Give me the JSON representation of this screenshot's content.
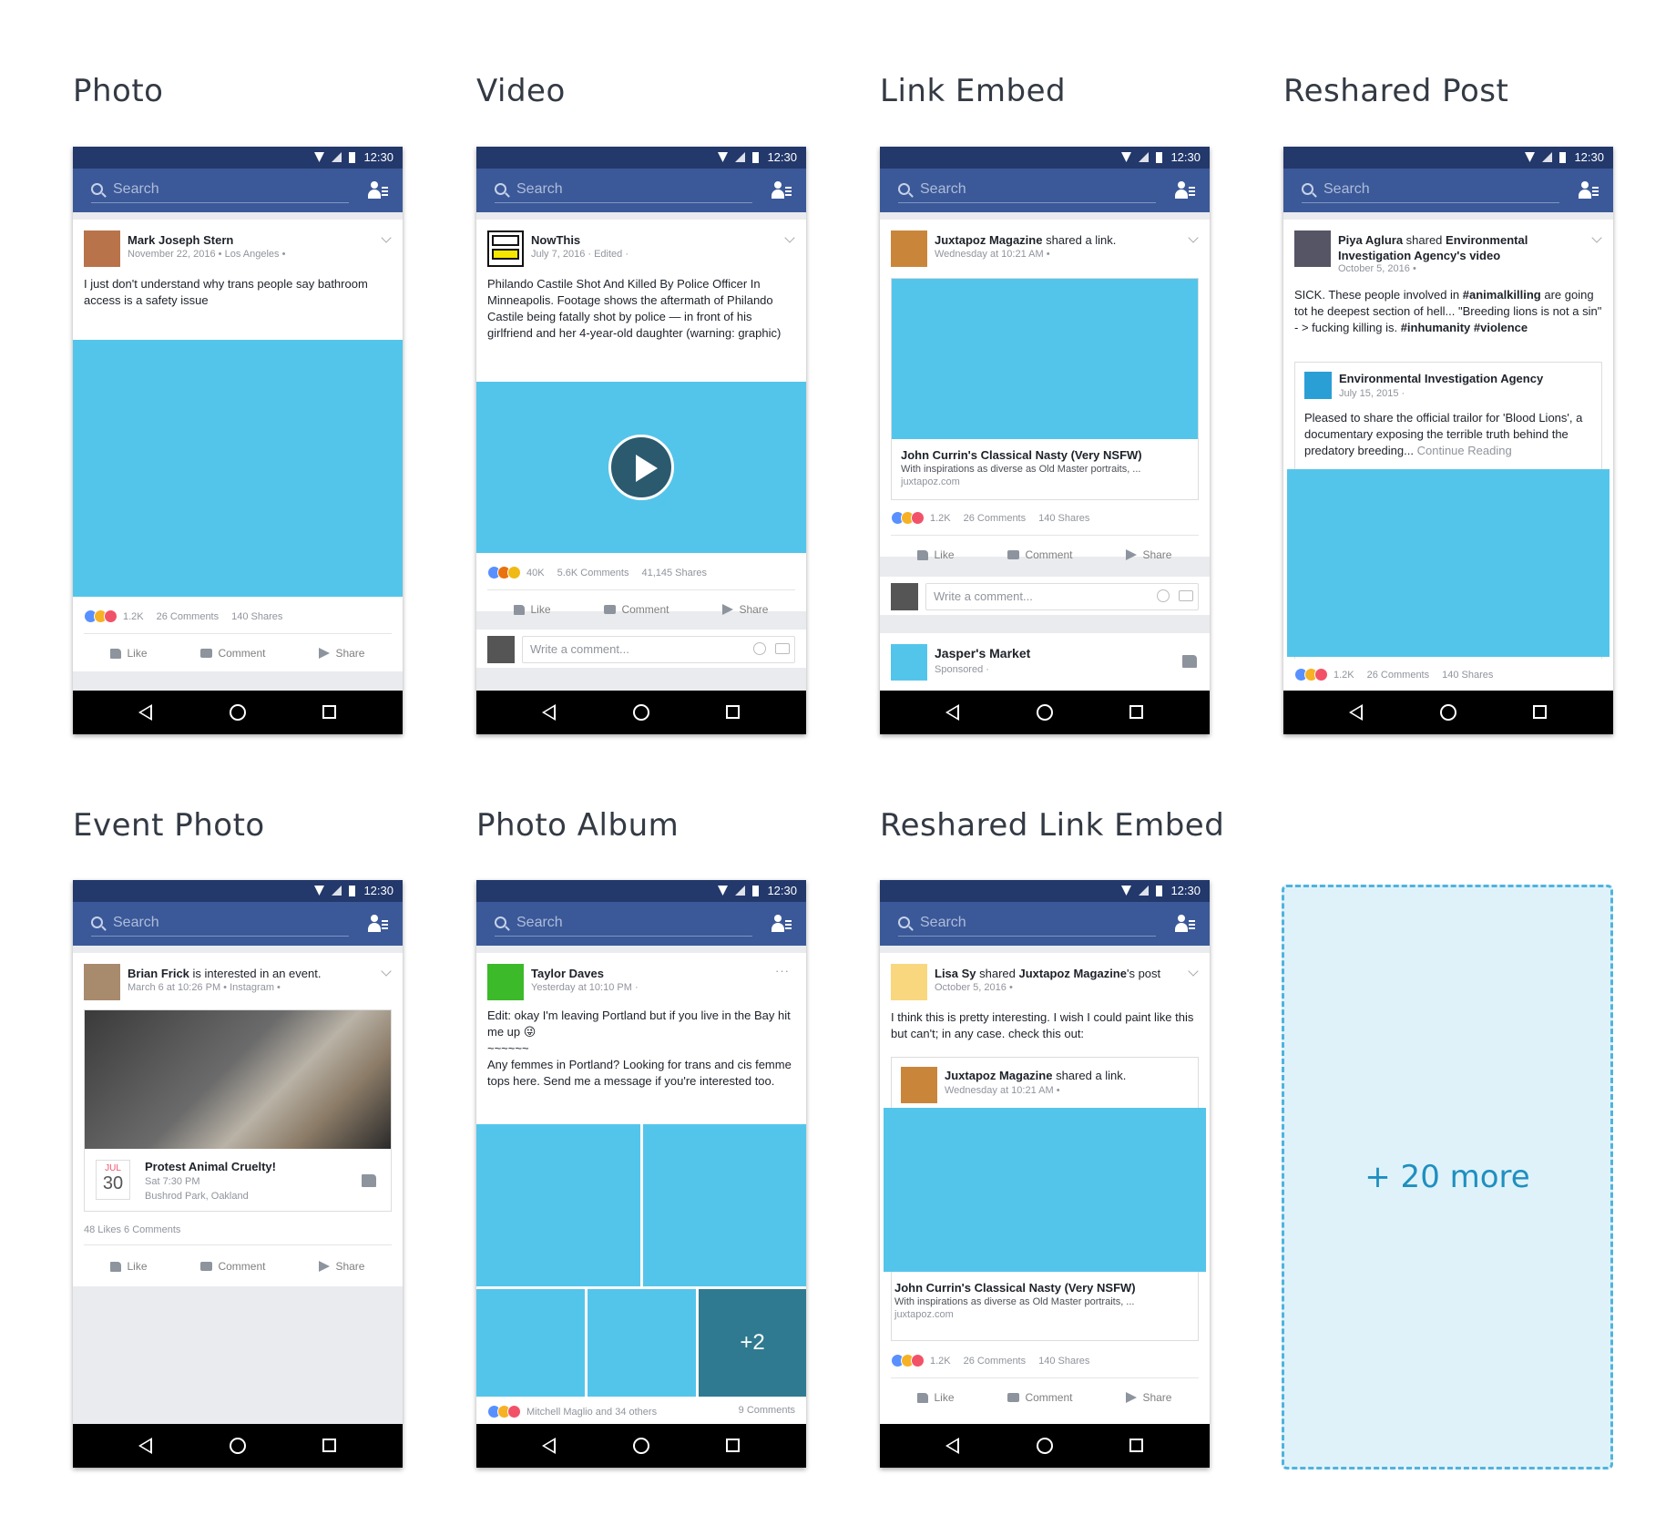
{
  "sections": {
    "photo": "Photo",
    "video": "Video",
    "link_embed": "Link Embed",
    "reshared_post": "Reshared Post",
    "event_photo": "Event Photo",
    "photo_album": "Photo Album",
    "reshared_link_embed": "Reshared Link Embed"
  },
  "common": {
    "time": "12:30",
    "search_placeholder": "Search",
    "like": "Like",
    "comment": "Comment",
    "share": "Share",
    "write_comment": "Write a comment...",
    "reactions_count": "1.2K",
    "comments_count": "26 Comments",
    "shares_count": "140 Shares"
  },
  "photo": {
    "author": "Mark Joseph Stern",
    "meta": "November 22, 2016 • Los Angeles •",
    "text": "I just don't understand why trans people say bathroom access is a safety issue"
  },
  "video": {
    "author": "NowThis",
    "meta": "July 7, 2016 · Edited ·",
    "text": "Philando Castile Shot And Killed By Police Officer In Minneapolis. Footage shows the aftermath of Philando Castile being fatally shot by police — in front of his girlfriend and her 4-year-old daughter (warning: graphic)",
    "reactions": "40K",
    "comments": "5.6K Comments",
    "shares": "41,145 Shares"
  },
  "link_embed": {
    "author": "Juxtapoz Magazine",
    "action": " shared a link.",
    "meta": "Wednesday at 10:21 AM •",
    "link_title": "John Currin's Classical Nasty (Very NSFW)",
    "link_desc": "With inspirations as diverse as Old Master portraits, ...",
    "link_domain": "juxtapoz.com",
    "sponsor_name": "Jasper's Market",
    "sponsor_meta": "Sponsored ·"
  },
  "reshared_post": {
    "author": "Piya Aglura",
    "action": " shared ",
    "target": "Environmental Investigation Agency's video",
    "meta": "October 5, 2016 •",
    "text_1": "SICK. These people involved in ",
    "tag_1": "#animalkilling",
    "text_2": " are going tot he deepest section of hell... \"Breeding lions is not a sin\" - > fucking killing is. ",
    "tag_2": "#inhumanity",
    "tag_3": "#violence",
    "inner_author": "Environmental Investigation Agency",
    "inner_meta": "July 15, 2015 ·",
    "inner_text": "Pleased to share the official trailor for 'Blood Lions', a documentary exposing the terrible truth behind the predatory breeding...",
    "continue": "Continue Reading"
  },
  "event_photo": {
    "author": "Brian Frick",
    "action": " is interested in an event.",
    "meta": "March 6 at 10:26 PM • Instagram •",
    "event_month": "JUL",
    "event_day": "30",
    "event_title": "Protest Animal Cruelty!",
    "event_time": "Sat 7:30 PM",
    "event_place": "Bushrod Park, Oakland",
    "counts": "48 Likes  6 Comments"
  },
  "photo_album": {
    "author": "Taylor Daves",
    "meta": "Yesterday at 10:10 PM ·",
    "text_1": "Edit: okay I'm leaving Portland but if you live in the Bay hit me up 😜",
    "text_2": "~~~~~~",
    "text_3": "Any femmes in Portland? Looking for trans and cis femme tops here. Send me a message if you're interested too.",
    "plus": "+2",
    "footer_left": "Mitchell Maglio  and 34 others",
    "footer_right": "9 Comments"
  },
  "reshared_link": {
    "author": "Lisa Sy",
    "action": " shared ",
    "target": "Juxtapoz Magazine",
    "action_2": "'s post",
    "meta": "October 5, 2016 •",
    "text": "I think this is pretty interesting. I wish I could paint like this but can't; in any case. check this out:",
    "inner_author": "Juxtapoz Magazine",
    "inner_action": " shared a link.",
    "inner_meta": "Wednesday at 10:21 AM •"
  },
  "more": "+ 20 more"
}
